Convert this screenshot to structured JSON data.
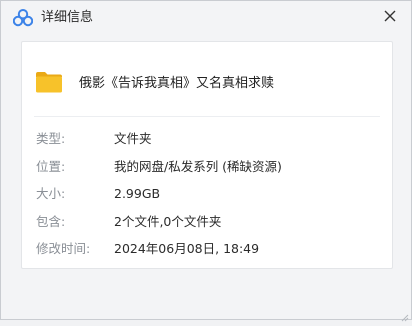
{
  "window": {
    "title": "详细信息",
    "app_icon": "baidu-netdisk-cloud-icon",
    "close_icon": "close-icon"
  },
  "file": {
    "icon": "folder-icon",
    "name": "俄影《告诉我真相》又名真相求赎"
  },
  "details": [
    {
      "label": "类型:",
      "value": "文件夹"
    },
    {
      "label": "位置:",
      "value": "我的网盘/私发系列 (稀缺资源)"
    },
    {
      "label": "大小:",
      "value": "2.99GB"
    },
    {
      "label": "包含:",
      "value": "2个文件,0个文件夹"
    },
    {
      "label": "修改时间:",
      "value": "2024年06月08日, 18:49"
    }
  ],
  "colors": {
    "folder": "#f7c22a",
    "folder_dark": "#eaa916",
    "icon_blue": "#3c83e8",
    "background": "#f3f4f6"
  }
}
